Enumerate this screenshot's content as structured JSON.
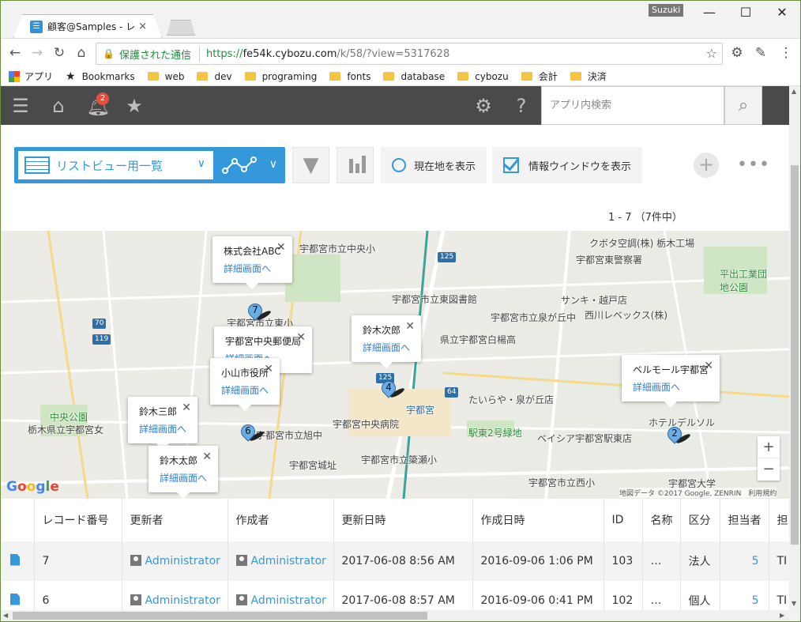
{
  "browser": {
    "tab_title": "顧客@Samples - レコードの",
    "user_badge": "Suzuki",
    "url_secure_label": "保護された通信",
    "url_scheme": "https://",
    "url_host": "fe54k.cybozu.com",
    "url_path": "/k/58/?view=5317628",
    "bookmarks": [
      "アプリ",
      "Bookmarks",
      "web",
      "dev",
      "programing",
      "fonts",
      "database",
      "cybozu",
      "会計",
      "決済"
    ]
  },
  "app_header": {
    "notification_count": "2",
    "search_placeholder": "アプリ内検索"
  },
  "view_bar": {
    "view_name": "リストビュー用一覧",
    "current_location_label": "現在地を表示",
    "info_window_label": "情報ウインドウを表示",
    "record_count": "1 - 7 （7件中）"
  },
  "map": {
    "labels": [
      "宇都宮市立東小",
      "宇都宮市立旭中",
      "宇都宮城址",
      "宇都宮中央病院",
      "宇都宮市立東図書館",
      "宇都宮市立泉が丘中",
      "県立宇都宮白楊高",
      "クボタ空調(株) 栃木工場",
      "宇都宮東警察署",
      "平出工業団地公園",
      "サンキ・越戸店",
      "西川レベックス(株)",
      "たいらや・泉が丘店",
      "駅東2号緑地",
      "ベイシア宇都宮駅東店",
      "ホテルデルソル",
      "宇都宮大学",
      "中央公園",
      "栃木県立宇都宮女",
      "宇都宮市立簗瀬小",
      "宇都宮市立西小",
      "宇都宮",
      "宇都宮市立中央小"
    ],
    "info_windows": [
      {
        "title": "株式会社ABC",
        "link": "詳細画面へ"
      },
      {
        "title": "鈴木次郎",
        "link": "詳細画面へ"
      },
      {
        "title": "宇都宮中央郵便局",
        "link": "詳細画面へ"
      },
      {
        "title": "小山市役所",
        "link": "詳細画面へ"
      },
      {
        "title": "ベルモール宇都宮",
        "link": "詳細画面へ"
      },
      {
        "title": "鈴木三郎",
        "link": "詳細画面へ"
      },
      {
        "title": "鈴木太郎",
        "link": "詳細画面へ"
      }
    ],
    "pins": [
      "7",
      "4",
      "6",
      "2"
    ],
    "attribution": "地図データ ©2017 Google, ZENRIN　利用規約",
    "google_logo": "Google"
  },
  "table": {
    "headers": [
      "",
      "レコード番号",
      "更新者",
      "作成者",
      "更新日時",
      "作成日時",
      "ID",
      "名称",
      "区分",
      "担当者",
      "担"
    ],
    "rows": [
      {
        "num": "7",
        "updater": "Administrator",
        "creator": "Administrator",
        "updated": "2017-06-08 8:56 AM",
        "created": "2016-09-06 1:06 PM",
        "id": "103",
        "name": "…",
        "kubun": "法人",
        "tanto": "5",
        "extra": "TI"
      },
      {
        "num": "6",
        "updater": "Administrator",
        "creator": "Administrator",
        "updated": "2017-06-08 8:57 AM",
        "created": "2016-09-06 0:41 PM",
        "id": "102",
        "name": "…",
        "kubun": "個人",
        "tanto": "5",
        "extra": "TI"
      }
    ]
  }
}
